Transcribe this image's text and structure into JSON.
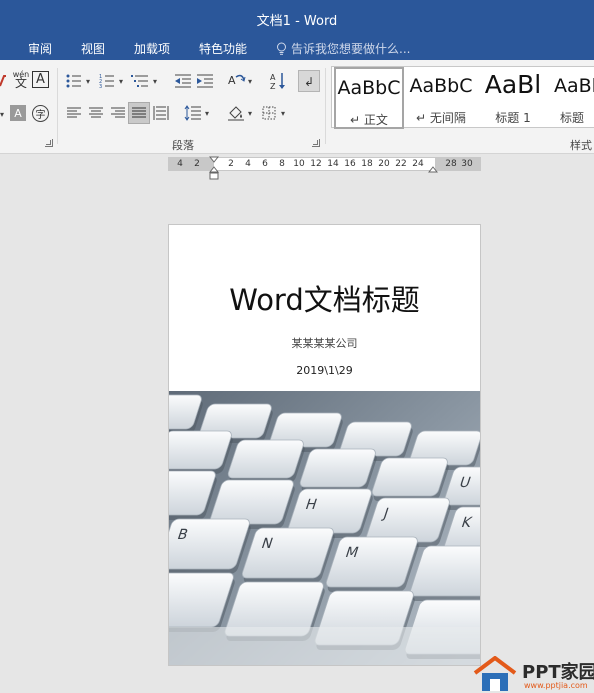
{
  "window": {
    "title": "文档1 - Word"
  },
  "tabs": [
    {
      "label": "审阅"
    },
    {
      "label": "视图"
    },
    {
      "label": "加载项"
    },
    {
      "label": "特色功能"
    }
  ],
  "tell_me": {
    "placeholder": "告诉我您想要做什么..."
  },
  "ribbon": {
    "font_group": {
      "phonetic_guide": "wén",
      "phonetic_char": "文",
      "char_border": "A",
      "char_shading": "A",
      "enclose_char": "字"
    },
    "paragraph_group": {
      "label": "段落"
    },
    "styles_group": {
      "label": "样式",
      "items": [
        {
          "sample": "AaBbC",
          "name": "正文",
          "selected": true
        },
        {
          "sample": "AaBbC",
          "name": "无间隔",
          "selected": false
        },
        {
          "sample": "AaBl",
          "name": "标题 1",
          "selected": false
        },
        {
          "sample": "AaBl",
          "name": "标题",
          "selected": false
        }
      ]
    }
  },
  "ruler": {
    "labels_left": [
      "4",
      "2"
    ],
    "labels_main": [
      "2",
      "4",
      "6",
      "8",
      "10",
      "12",
      "14",
      "16",
      "18",
      "20",
      "22",
      "24"
    ],
    "labels_right": [
      "28",
      "30"
    ]
  },
  "document": {
    "title": "Word文档标题",
    "company": "某某某某公司",
    "date": "2019\\1\\29",
    "keyboard_keys": [
      "U",
      "H",
      "J",
      "K",
      "B",
      "N",
      "M"
    ]
  },
  "watermark": {
    "text": "PPT家园",
    "url": "www.pptjia.com"
  },
  "colors": {
    "title_bar": "#2b579a",
    "ribbon": "#f3f3f3",
    "workspace": "#e6e6e6",
    "watermark_accent": "#e35a1a"
  }
}
